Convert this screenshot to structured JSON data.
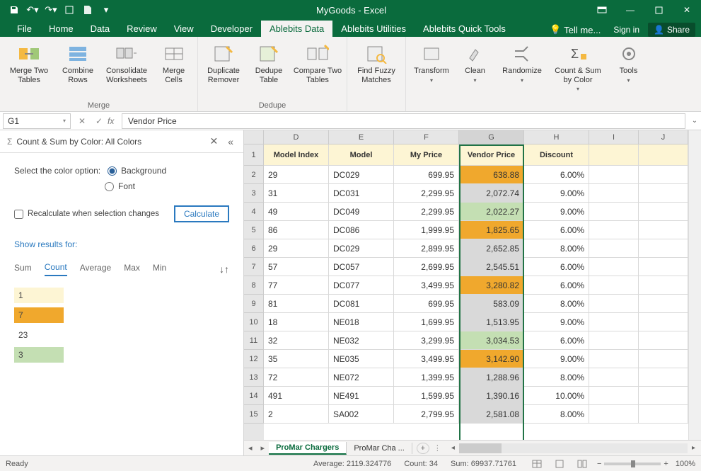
{
  "titlebar": {
    "title": "MyGoods - Excel"
  },
  "tabs": [
    "File",
    "Home",
    "Data",
    "Review",
    "View",
    "Developer",
    "Ablebits Data",
    "Ablebits Utilities",
    "Ablebits Quick Tools"
  ],
  "active_tab": "Ablebits Data",
  "tellme": "Tell me...",
  "signin": "Sign in",
  "share": "Share",
  "ribbon": {
    "groups": [
      {
        "label": "Merge",
        "items": [
          "Merge Two Tables",
          "Combine Rows",
          "Consolidate Worksheets",
          "Merge Cells"
        ]
      },
      {
        "label": "Dedupe",
        "items": [
          "Duplicate Remover",
          "Dedupe Table",
          "Compare Two Tables"
        ]
      },
      {
        "label": "",
        "items": [
          "Find Fuzzy Matches"
        ]
      },
      {
        "label": "",
        "items": [
          "Transform",
          "Clean",
          "Randomize",
          "Count & Sum by Color",
          "Tools"
        ]
      }
    ]
  },
  "fbar": {
    "name": "G1",
    "formula": "Vendor Price"
  },
  "panel": {
    "title": "Count & Sum by Color: All Colors",
    "select_label": "Select the color option:",
    "opt_bg": "Background",
    "opt_font": "Font",
    "recalc": "Recalculate when selection changes",
    "calc_btn": "Calculate",
    "showfor": "Show results for:",
    "stats": [
      "Sum",
      "Count",
      "Average",
      "Max",
      "Min"
    ],
    "active_stat": "Count",
    "results": [
      {
        "swatch": "sw-pale",
        "val": "1"
      },
      {
        "swatch": "sw-orange",
        "val": "7"
      },
      {
        "swatch": "sw-none",
        "val": "23"
      },
      {
        "swatch": "sw-green",
        "val": "3"
      }
    ]
  },
  "sheet": {
    "cols": [
      "D",
      "E",
      "F",
      "G",
      "H",
      "I",
      "J"
    ],
    "selected_col": "G",
    "headers": [
      "Model Index",
      "Model",
      "My Price",
      "Vendor Price",
      "Discount"
    ],
    "rows": [
      {
        "n": 1
      },
      {
        "n": 2,
        "d": "29",
        "e": "DC029",
        "f": "699.95",
        "g": "638.88",
        "gbg": "bg-orange",
        "h": "6.00%"
      },
      {
        "n": 3,
        "d": "31",
        "e": "DC031",
        "f": "2,299.95",
        "g": "2,072.74",
        "gbg": "bg-gray",
        "h": "9.00%"
      },
      {
        "n": 4,
        "d": "49",
        "e": "DC049",
        "f": "2,299.95",
        "g": "2,022.27",
        "gbg": "bg-green",
        "h": "9.00%"
      },
      {
        "n": 5,
        "d": "86",
        "e": "DC086",
        "f": "1,999.95",
        "g": "1,825.65",
        "gbg": "bg-orange",
        "h": "6.00%"
      },
      {
        "n": 6,
        "d": "29",
        "e": "DC029",
        "f": "2,899.95",
        "g": "2,652.85",
        "gbg": "bg-gray",
        "h": "8.00%"
      },
      {
        "n": 7,
        "d": "57",
        "e": "DC057",
        "f": "2,699.95",
        "g": "2,545.51",
        "gbg": "bg-gray",
        "h": "6.00%"
      },
      {
        "n": 8,
        "d": "77",
        "e": "DC077",
        "f": "3,499.95",
        "g": "3,280.82",
        "gbg": "bg-orange",
        "h": "6.00%"
      },
      {
        "n": 9,
        "d": "81",
        "e": "DC081",
        "f": "699.95",
        "g": "583.09",
        "gbg": "bg-gray",
        "h": "8.00%"
      },
      {
        "n": 10,
        "d": "18",
        "e": "NE018",
        "f": "1,699.95",
        "g": "1,513.95",
        "gbg": "bg-gray",
        "h": "9.00%"
      },
      {
        "n": 11,
        "d": "32",
        "e": "NE032",
        "f": "3,299.95",
        "g": "3,034.53",
        "gbg": "bg-green",
        "h": "6.00%"
      },
      {
        "n": 12,
        "d": "35",
        "e": "NE035",
        "f": "3,499.95",
        "g": "3,142.90",
        "gbg": "bg-orange",
        "h": "9.00%"
      },
      {
        "n": 13,
        "d": "72",
        "e": "NE072",
        "f": "1,399.95",
        "g": "1,288.96",
        "gbg": "bg-gray",
        "h": "8.00%"
      },
      {
        "n": 14,
        "d": "491",
        "e": "NE491",
        "f": "1,599.95",
        "g": "1,390.16",
        "gbg": "bg-gray",
        "h": "10.00%"
      },
      {
        "n": 15,
        "d": "2",
        "e": "SA002",
        "f": "2,799.95",
        "g": "2,581.08",
        "gbg": "bg-gray",
        "h": "8.00%"
      }
    ],
    "tabs": [
      {
        "name": "ProMar Chargers",
        "active": true
      },
      {
        "name": "ProMar Cha ...",
        "active": false
      }
    ]
  },
  "status": {
    "ready": "Ready",
    "avg": "Average: 2119.324776",
    "count": "Count: 34",
    "sum": "Sum: 69937.71761",
    "zoom": "100%"
  }
}
